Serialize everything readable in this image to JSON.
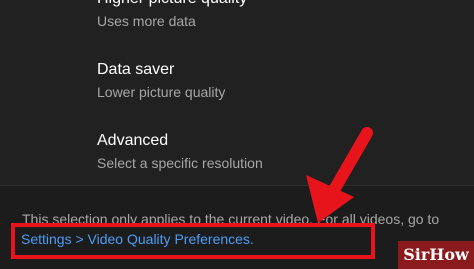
{
  "options": [
    {
      "title": "Higher picture quality",
      "subtitle": "Uses more data"
    },
    {
      "title": "Data saver",
      "subtitle": "Lower picture quality"
    },
    {
      "title": "Advanced",
      "subtitle": "Select a specific resolution"
    }
  ],
  "footer": {
    "note": "This selection only applies to the current video. For all videos, go to",
    "link": "Settings > Video Quality Preferences."
  },
  "watermark": {
    "text": "SirHow"
  },
  "colors": {
    "background": "#212121",
    "link": "#4e9cf5",
    "annotation_red": "#e8141b",
    "watermark_bg": "#8b1a1c"
  }
}
